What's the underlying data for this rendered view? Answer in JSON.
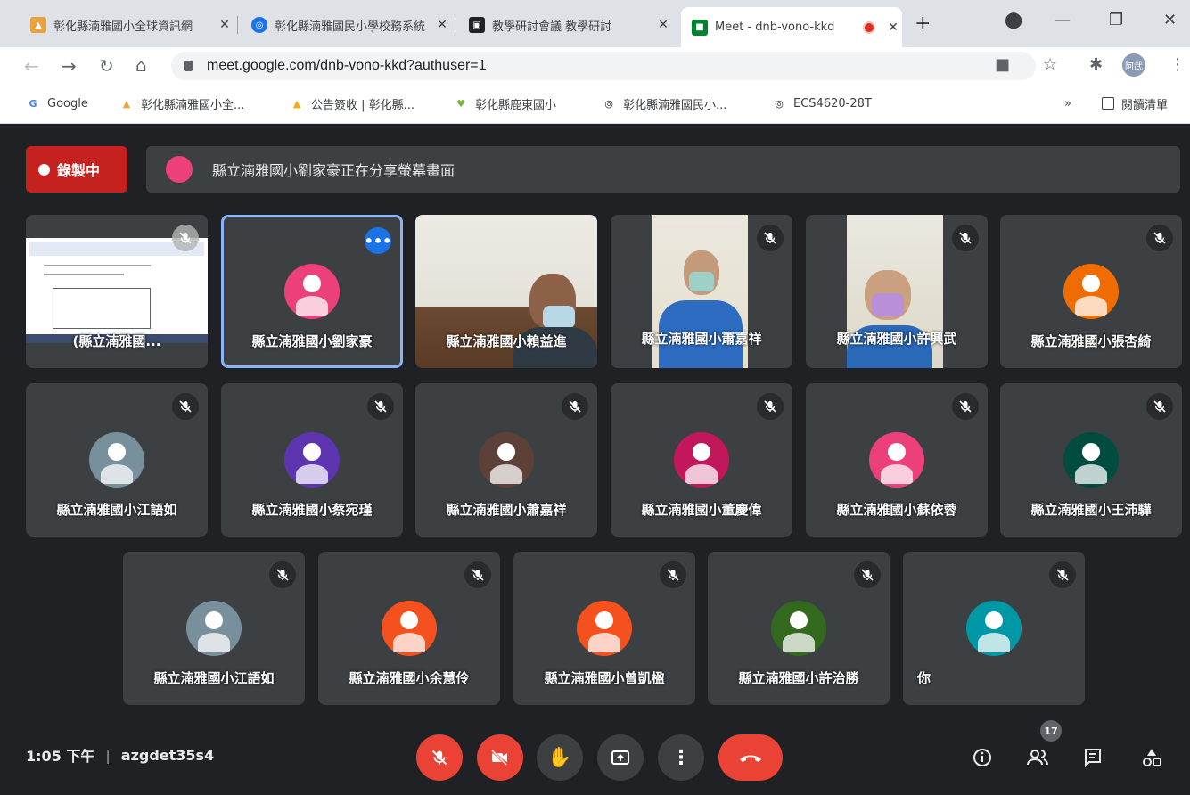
{
  "browser": {
    "tabs": [
      {
        "title": "彰化縣湳雅國小全球資訊網",
        "favicon_color": "#e8a33d"
      },
      {
        "title": "彰化縣湳雅國民小學校務系統",
        "favicon_color": "#1a73e8"
      },
      {
        "title": "教學研討會議 教學研討",
        "favicon_color": "#202124"
      },
      {
        "title": "Meet - dnb-vono-kkd",
        "favicon_color": "#00832d"
      }
    ],
    "new_tab": "+",
    "url": "meet.google.com/dnb-vono-kkd?authuser=1",
    "profile_label": "阿武",
    "bookmarks": [
      {
        "label": "Google",
        "icon": "G"
      },
      {
        "label": "彰化縣湳雅國小全...",
        "icon": "▲"
      },
      {
        "label": "公告簽收 | 彰化縣...",
        "icon": "▲"
      },
      {
        "label": "彰化縣鹿東國小",
        "icon": "♥"
      },
      {
        "label": "彰化縣湳雅國民小...",
        "icon": "◎"
      },
      {
        "label": "ECS4620-28T",
        "icon": "◎"
      }
    ],
    "more_bookmarks": "»",
    "reading_list": "閱讀清單"
  },
  "meet": {
    "recording_label": "錄製中",
    "presenting_banner": "縣立湳雅國小劉家豪正在分享螢幕畫面",
    "participants": [
      {
        "name": "(縣立湳雅國...",
        "type": "screen",
        "muted": true
      },
      {
        "name": "縣立湳雅國小劉家豪",
        "type": "avatar",
        "color": "#ec407a",
        "selected": true
      },
      {
        "name": "縣立湳雅國小賴益進",
        "type": "video"
      },
      {
        "name": "縣立湳雅國小蕭嘉祥",
        "type": "video",
        "muted": true
      },
      {
        "name": "縣立湳雅國小許興武",
        "type": "video",
        "muted": true
      },
      {
        "name": "縣立湳雅國小張杏綺",
        "type": "avatar",
        "color": "#ef6c00",
        "muted": true
      },
      {
        "name": "縣立湳雅國小江語如",
        "type": "avatar",
        "color": "#78909c",
        "muted": true
      },
      {
        "name": "縣立湳雅國小蔡宛瑾",
        "type": "avatar",
        "color": "#5e35b1",
        "muted": true
      },
      {
        "name": "縣立湳雅國小蕭嘉祥",
        "type": "avatar",
        "color": "#5d4037",
        "muted": true
      },
      {
        "name": "縣立湳雅國小董慶偉",
        "type": "avatar",
        "color": "#c2185b",
        "muted": true
      },
      {
        "name": "縣立湳雅國小蘇依蓉",
        "type": "avatar",
        "color": "#ec407a",
        "muted": true
      },
      {
        "name": "縣立湳雅國小王沛驊",
        "type": "avatar",
        "color": "#004d40",
        "muted": true
      },
      {
        "name": "縣立湳雅國小江語如",
        "type": "avatar",
        "color": "#78909c",
        "muted": true
      },
      {
        "name": "縣立湳雅國小余慧伶",
        "type": "avatar",
        "color": "#f4511e",
        "muted": true
      },
      {
        "name": "縣立湳雅國小曾凱楹",
        "type": "avatar",
        "color": "#f4511e",
        "muted": true
      },
      {
        "name": "縣立湳雅國小許治勝",
        "type": "avatar",
        "color": "#33691e",
        "muted": true
      },
      {
        "name": "你",
        "type": "avatar",
        "color": "#0097a7",
        "muted": true
      }
    ],
    "time": "1:05 下午",
    "meeting_code": "azgdet35s4",
    "participant_count": "17"
  }
}
